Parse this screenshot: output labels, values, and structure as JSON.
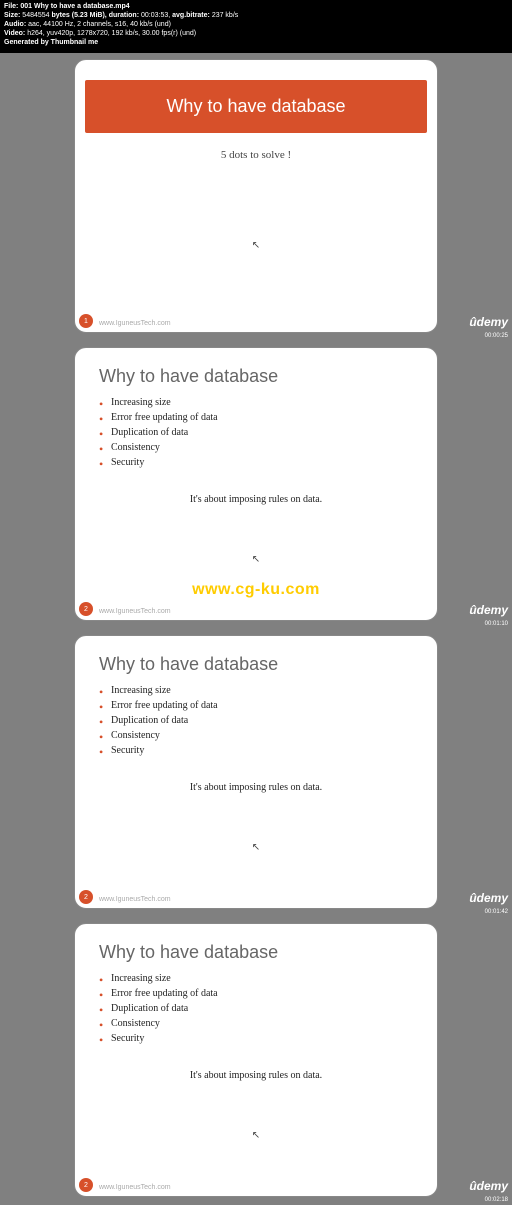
{
  "meta": {
    "line1_label": "File: ",
    "line1_value": "001 Why to have a database.mp4",
    "line2_size_label": "Size: ",
    "line2_size_value": "5484554",
    "line2_bytes": " bytes (5.23 MiB), ",
    "line2_dur_label": "duration: ",
    "line2_dur_value": "00:03:53,",
    "line2_br_label": " avg.bitrate: ",
    "line2_br_value": "237 kb/s",
    "line3_label": "Audio: ",
    "line3_value": "aac, 44100 Hz, 2 channels, s16, 40 kb/s (und)",
    "line4_label": "Video: ",
    "line4_value": "h264, yuv420p, 1278x720, 192 kb/s, 30.00 fps(r) (und)",
    "line5": "Generated by Thumbnail me"
  },
  "branding": {
    "udemy": "ûdemy",
    "watermark": "www.cg-ku.com"
  },
  "frames": [
    {
      "layout": "title",
      "title": "Why to have database",
      "sub": "5 dots to solve !",
      "pageNum": "1",
      "footer": "www.IguneusTech.com",
      "timestamp": "00:00:25"
    },
    {
      "layout": "bullets",
      "heading": "Why to have database",
      "bullets": [
        "Increasing size",
        "Error free updating of data",
        "Duplication of data",
        "Consistency",
        "Security"
      ],
      "rule": "It's about imposing rules on data.",
      "pageNum": "2",
      "footer": "www.IguneusTech.com",
      "timestamp": "00:01:10",
      "watermark": true
    },
    {
      "layout": "bullets",
      "heading": "Why to have database",
      "bullets": [
        "Increasing size",
        "Error free updating of data",
        "Duplication of data",
        "Consistency",
        "Security"
      ],
      "rule": "It's about imposing rules on data.",
      "pageNum": "2",
      "footer": "www.IguneusTech.com",
      "timestamp": "00:01:42"
    },
    {
      "layout": "bullets",
      "heading": "Why to have database",
      "bullets": [
        "Increasing size",
        "Error free updating of data",
        "Duplication of data",
        "Consistency",
        "Security"
      ],
      "rule": "It's about imposing rules on data.",
      "pageNum": "2",
      "footer": "www.IguneusTech.com",
      "timestamp": "00:02:18"
    }
  ]
}
